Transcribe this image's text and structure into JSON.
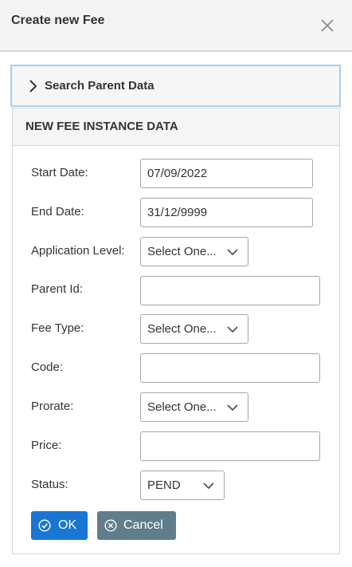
{
  "dialog": {
    "title": "Create new Fee",
    "close_icon": "close-icon"
  },
  "accordion": {
    "label": "Search Parent Data",
    "icon": "chevron-right-icon"
  },
  "panel": {
    "title": "NEW FEE INSTANCE DATA"
  },
  "form": {
    "start_date": {
      "label": "Start Date:",
      "value": "07/09/2022"
    },
    "end_date": {
      "label": "End Date:",
      "value": "31/12/9999"
    },
    "application_level": {
      "label": "Application Level:",
      "selected": "Select One..."
    },
    "parent_id": {
      "label": "Parent Id:",
      "value": ""
    },
    "fee_type": {
      "label": "Fee Type:",
      "selected": "Select One..."
    },
    "code": {
      "label": "Code:",
      "value": ""
    },
    "prorate": {
      "label": "Prorate:",
      "selected": "Select One..."
    },
    "price": {
      "label": "Price:",
      "value": ""
    },
    "status": {
      "label": "Status:",
      "selected": "PEND"
    }
  },
  "buttons": {
    "ok": {
      "label": "OK",
      "icon": "check-circle-icon",
      "color": "#1976d2"
    },
    "cancel": {
      "label": "Cancel",
      "icon": "x-circle-icon",
      "color": "#607d8b"
    }
  },
  "colors": {
    "accordion_border": "#a9cdeb",
    "header_bg": "#f4f4f4"
  }
}
